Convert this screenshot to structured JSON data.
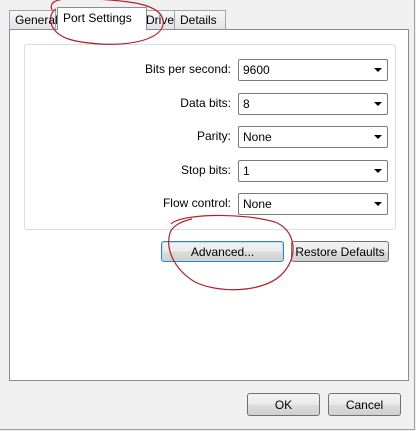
{
  "tabs": [
    {
      "label": "General"
    },
    {
      "label": "Port Settings"
    },
    {
      "label": "Driver"
    },
    {
      "label": "Details"
    }
  ],
  "fields": {
    "bits_per_second": {
      "label": "Bits per second:",
      "value": "9600"
    },
    "data_bits": {
      "label": "Data bits:",
      "value": "8"
    },
    "parity": {
      "label": "Parity:",
      "value": "None"
    },
    "stop_bits": {
      "label": "Stop bits:",
      "value": "1"
    },
    "flow_control": {
      "label": "Flow control:",
      "value": "None"
    }
  },
  "buttons": {
    "advanced": "Advanced...",
    "restore_defaults": "Restore Defaults",
    "ok": "OK",
    "cancel": "Cancel"
  },
  "colors": {
    "annotation": "#b0202a",
    "focus_border": "#3c7fb1"
  }
}
